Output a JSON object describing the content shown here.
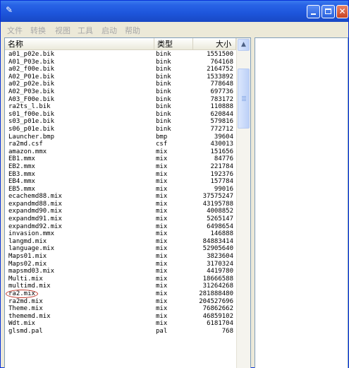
{
  "window": {
    "title": ""
  },
  "menu": [
    "文件",
    "转换",
    "视图",
    "工具",
    "启动",
    "帮助"
  ],
  "columns": {
    "name": "名称",
    "type": "类型",
    "size": "大小"
  },
  "files": [
    {
      "name": "a01_p02e.bik",
      "type": "bink",
      "size": "1551500"
    },
    {
      "name": "A01_P03e.bik",
      "type": "bink",
      "size": "764168"
    },
    {
      "name": "a02_f00e.bik",
      "type": "bink",
      "size": "2164752"
    },
    {
      "name": "A02_P01e.bik",
      "type": "bink",
      "size": "1533892"
    },
    {
      "name": "a02_p02e.bik",
      "type": "bink",
      "size": "778648"
    },
    {
      "name": "A02_P03e.bik",
      "type": "bink",
      "size": "697736"
    },
    {
      "name": "A03_F00e.bik",
      "type": "bink",
      "size": "783172"
    },
    {
      "name": "ra2ts_l.bik",
      "type": "bink",
      "size": "110888"
    },
    {
      "name": "s01_f00e.bik",
      "type": "bink",
      "size": "620844"
    },
    {
      "name": "s03_p01e.bik",
      "type": "bink",
      "size": "579816"
    },
    {
      "name": "s06_p01e.bik",
      "type": "bink",
      "size": "772712"
    },
    {
      "name": "Launcher.bmp",
      "type": "bmp",
      "size": "39604"
    },
    {
      "name": "ra2md.csf",
      "type": "csf",
      "size": "430013"
    },
    {
      "name": "amazon.mmx",
      "type": "mix",
      "size": "151656"
    },
    {
      "name": "EB1.mmx",
      "type": "mix",
      "size": "84776"
    },
    {
      "name": "EB2.mmx",
      "type": "mix",
      "size": "221784"
    },
    {
      "name": "EB3.mmx",
      "type": "mix",
      "size": "192376"
    },
    {
      "name": "EB4.mmx",
      "type": "mix",
      "size": "157784"
    },
    {
      "name": "EB5.mmx",
      "type": "mix",
      "size": "99016"
    },
    {
      "name": "ecachemd88.mix",
      "type": "mix",
      "size": "37575247"
    },
    {
      "name": "expandmd88.mix",
      "type": "mix",
      "size": "43195788"
    },
    {
      "name": "expandmd90.mix",
      "type": "mix",
      "size": "4008852"
    },
    {
      "name": "expandmd91.mix",
      "type": "mix",
      "size": "5265147"
    },
    {
      "name": "expandmd92.mix",
      "type": "mix",
      "size": "6498654"
    },
    {
      "name": "invasion.mmx",
      "type": "mix",
      "size": "146888"
    },
    {
      "name": "langmd.mix",
      "type": "mix",
      "size": "84883414"
    },
    {
      "name": "language.mix",
      "type": "mix",
      "size": "52905640"
    },
    {
      "name": "Maps01.mix",
      "type": "mix",
      "size": "3823604"
    },
    {
      "name": "Maps02.mix",
      "type": "mix",
      "size": "3170324"
    },
    {
      "name": "mapsmd03.mix",
      "type": "mix",
      "size": "4419780"
    },
    {
      "name": "Multi.mix",
      "type": "mix",
      "size": "18666588"
    },
    {
      "name": "multimd.mix",
      "type": "mix",
      "size": "31264268"
    },
    {
      "name": "ra2.mix",
      "type": "mix",
      "size": "281888480"
    },
    {
      "name": "ra2md.mix",
      "type": "mix",
      "size": "204527696"
    },
    {
      "name": "Theme.mix",
      "type": "mix",
      "size": "76862662"
    },
    {
      "name": "thememd.mix",
      "type": "mix",
      "size": "46859102"
    },
    {
      "name": "Wdt.mix",
      "type": "mix",
      "size": "6181704"
    },
    {
      "name": "glsmd.pal",
      "type": "pal",
      "size": "768"
    }
  ],
  "highlighted_file": "ra2.mix",
  "colors": {
    "titlebar": "#2863e6",
    "menu_text_disabled": "#a7a7a7",
    "highlight_circle": "#c0392b"
  },
  "icons": {
    "app": "app-icon",
    "minimize": "minimize-icon",
    "maximize": "maximize-icon",
    "close": "close-icon",
    "scroll_up": "arrow-up-icon"
  }
}
